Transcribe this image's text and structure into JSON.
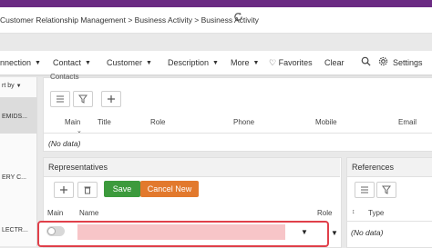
{
  "breadcrumb": "Customer Relationship Management > Business Activity > Business Activity",
  "menu": {
    "items": [
      "nnection",
      "Contact",
      "Customer",
      "Description",
      "More"
    ],
    "favorites": "Favorites",
    "clear": "Clear",
    "settings": "Settings"
  },
  "sidebar": {
    "sort_by": "rt by",
    "rows": [
      "EMIDS...",
      "ERY C...",
      "LECTR..."
    ]
  },
  "contacts": {
    "title": "Contacts",
    "columns": [
      "Main",
      "Title",
      "Role",
      "Phone",
      "Mobile",
      "Email"
    ],
    "empty": "(No data)"
  },
  "representatives": {
    "title": "Representatives",
    "save": "Save",
    "cancel_new": "Cancel New",
    "columns": [
      "Main",
      "Name",
      "Role"
    ]
  },
  "references": {
    "title": "References",
    "columns": [
      "Type"
    ],
    "empty": "(No data)"
  },
  "colors": {
    "accent": "#6b2b83",
    "save": "#3c9a3c",
    "cancel": "#e2792d",
    "error": "#e0404a"
  }
}
